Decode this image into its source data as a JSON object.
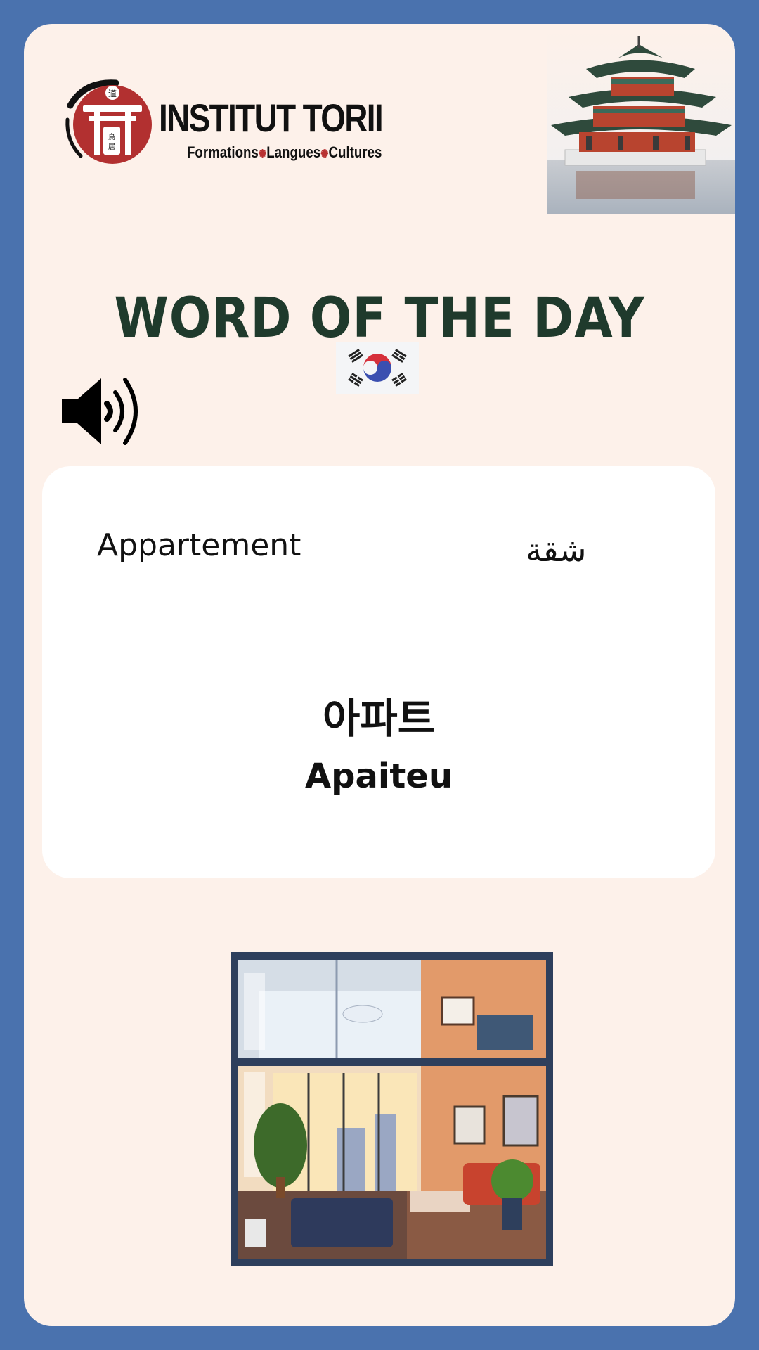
{
  "brand": {
    "name": "INSTITUT TORII",
    "tagline_parts": [
      "Formations",
      "Langues",
      "Cultures"
    ],
    "emblem_kanji_top": "道",
    "emblem_kanji_side": "鳥居",
    "accent_color": "#b83232"
  },
  "title": "WORD OF THE DAY",
  "language_flag": "south-korea-flag",
  "word": {
    "french": "Appartement",
    "arabic": "شقة",
    "korean": "아파트",
    "romanization": "Apaiteu"
  },
  "colors": {
    "border": "#4a72ae",
    "background": "#fdf1ea",
    "panel": "#ffffff",
    "title": "#1f3a2c"
  },
  "icons": {
    "audio": "speaker-icon"
  }
}
